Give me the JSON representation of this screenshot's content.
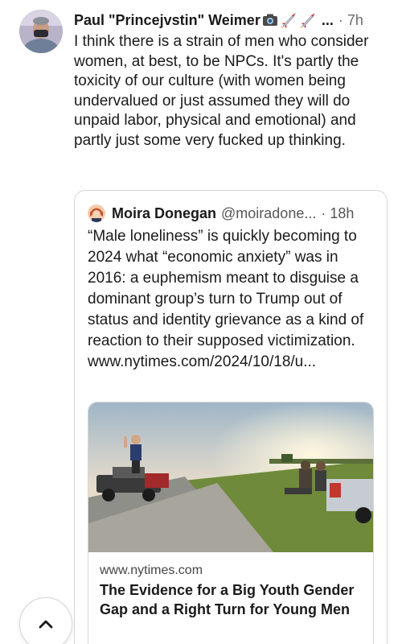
{
  "post": {
    "author_name": "Paul \"Princejvstin\" Weimer",
    "badges": [
      "camera-emoji",
      "rocket-emoji",
      "rocket-emoji"
    ],
    "ellipsis": "...",
    "timestamp": "· 7h",
    "body": "I think there is a strain of men who consider women, at best, to be NPCs.  It's partly the toxicity of our culture (with women being undervalued or just assumed they will do unpaid labor, physical and emotional) and partly just some very fucked up thinking."
  },
  "quote": {
    "author_name": "Moira Donegan",
    "handle": "@moiradone...",
    "timestamp": "· 18h",
    "body": "“Male loneliness” is quickly becoming to 2024 what “economic anxiety” was in 2016: a euphemism meant to disguise a dominant group’s turn to Trump out of status and identity grievance as a kind of reaction to their supposed victimization. www.nytimes.com/2024/10/18/u...",
    "link_card": {
      "domain": "www.nytimes.com",
      "title": "The Evidence for a Big Youth Gender Gap and a Right Turn for Young Men"
    }
  },
  "controls": {
    "scroll_top_icon": "chevron-up-icon"
  }
}
